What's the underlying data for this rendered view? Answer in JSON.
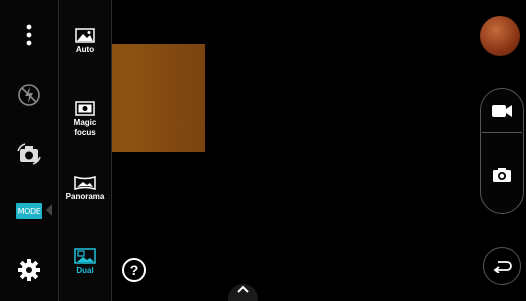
{
  "rail": {
    "menu_icon": "more-vertical-icon",
    "flash_icon": "flash-off-icon",
    "swap_icon": "switch-camera-icon",
    "mode_label": "MODE",
    "settings_icon": "settings-gear-icon"
  },
  "modes": [
    {
      "label": "Auto",
      "icon": "auto-landscape-icon",
      "active": false
    },
    {
      "label": "Magic\nfocus",
      "icon": "magic-focus-icon",
      "active": false
    },
    {
      "label": "Panorama",
      "icon": "panorama-icon",
      "active": false
    },
    {
      "label": "Dual",
      "icon": "dual-camera-icon",
      "active": true
    }
  ],
  "help": {
    "label": "?"
  },
  "controls": {
    "video_icon": "video-record-icon",
    "shutter_icon": "camera-shutter-icon",
    "back_icon": "back-arrow-icon",
    "expand_icon": "chevron-up-icon"
  },
  "colors": {
    "accent": "#21c2dc",
    "mode_badge": "#1fb3c9",
    "highlight": "#8d5311"
  }
}
